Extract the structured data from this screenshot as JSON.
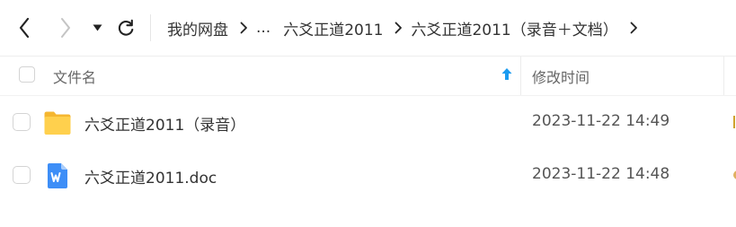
{
  "nav": {
    "back_icon": "chevron-left-icon",
    "forward_icon": "chevron-right-icon",
    "history_icon": "caret-down-icon",
    "refresh_icon": "refresh-icon"
  },
  "breadcrumb": {
    "root": "我的网盘",
    "ellipsis": "...",
    "level1": "六爻正道2011",
    "current": "六爻正道2011（录音＋文档）"
  },
  "table": {
    "col_name": "文件名",
    "col_time": "修改时间",
    "sort": "ascending",
    "rows": [
      {
        "name": "六爻正道2011（录音）",
        "type": "folder",
        "icon": "folder-icon",
        "modified": "2023-11-22 14:49"
      },
      {
        "name": "六爻正道2011.doc",
        "type": "word-doc",
        "icon": "word-doc-icon",
        "modified": "2023-11-22 14:48"
      }
    ]
  },
  "colors": {
    "accent": "#1a9bf0",
    "folder": "#ffc94a",
    "word": "#3d8ef7"
  }
}
